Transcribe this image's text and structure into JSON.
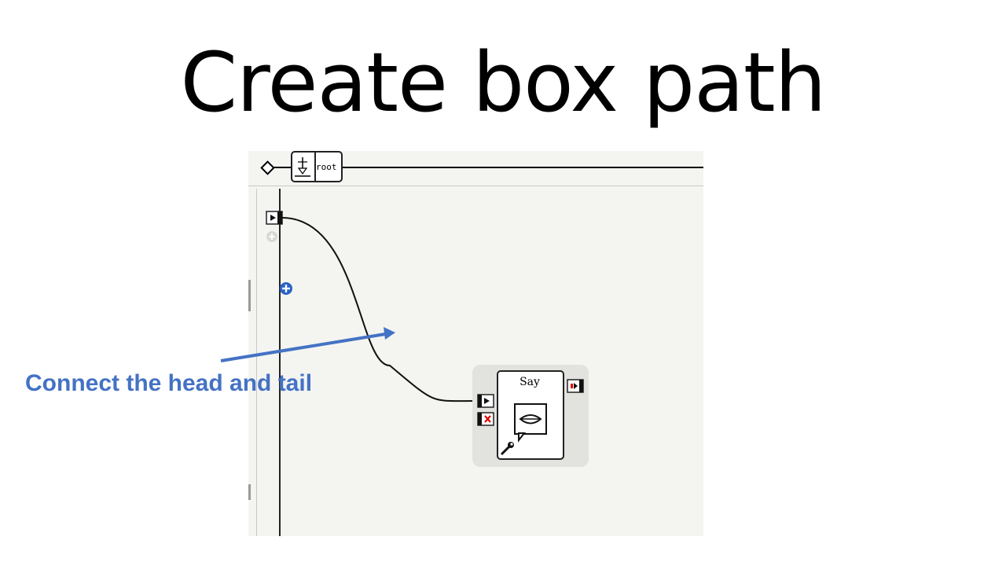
{
  "slide": {
    "title": "Create box path",
    "annotation": "Connect the head and tail"
  },
  "path_bar": {
    "root_label": "root",
    "icons": [
      "diamond-icon",
      "root-behavior-icon"
    ]
  },
  "flow": {
    "start_input_icon": "play-icon",
    "add_input_icon": "plus-icon",
    "add_output_icon": "plus-icon"
  },
  "say_box": {
    "title": "Say",
    "icons": [
      "play-icon",
      "stop-icon",
      "mouth-icon",
      "wrench-icon",
      "output-signal-icon"
    ]
  },
  "colors": {
    "annotation": "#4472c4",
    "arrow": "#4472c4",
    "stop_red": "#e00000",
    "plus_blue": "#2962c4"
  }
}
